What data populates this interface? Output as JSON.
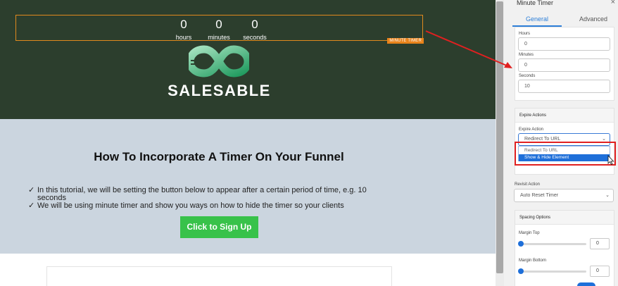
{
  "timer": {
    "hours_value": "0",
    "hours_label": "hours",
    "minutes_value": "0",
    "minutes_label": "minutes",
    "seconds_value": "0",
    "seconds_label": "seconds",
    "tag": "MINUTE TIMER"
  },
  "hero": {
    "brand": "SALESABLE",
    "logo_icon": "infinity-logo-icon"
  },
  "content": {
    "headline": "How To Incorporate A Timer On Your Funnel",
    "bullets": [
      "In this tutorial, we will be setting the button below to appear after a certain period of time, e.g. 10 seconds",
      "We will be using minute timer and show you ways on how to hide the timer so your clients"
    ],
    "check_glyph": "✓",
    "cta": "Click to Sign Up"
  },
  "panel": {
    "title": "Minute Timer",
    "close_glyph": "×",
    "tabs": [
      "General",
      "Advanced"
    ],
    "time_fields": {
      "hours_label": "Hours",
      "hours_value": "0",
      "minutes_label": "Minutes",
      "minutes_value": "0",
      "seconds_label": "Seconds",
      "seconds_value": "10"
    },
    "expire": {
      "heading": "Expire Actions",
      "action_label": "Expire Action",
      "action_value": "Redirect To URL",
      "options": [
        "Redirect To URL",
        "Show & Hide Element"
      ],
      "selected_option": "Show & Hide Element"
    },
    "revisit": {
      "label": "Revisit Action",
      "value": "Auto Reset Timer"
    },
    "spacing": {
      "heading": "Spacing Options",
      "margin_top_label": "Margin Top",
      "margin_top_value": "0",
      "margin_bottom_label": "Margin Bottom",
      "margin_bottom_value": "0"
    }
  },
  "colors": {
    "hero_bg": "#2c3e2d",
    "timer_border": "#e08a1e",
    "cta_bg": "#38c24a",
    "accent_blue": "#1e6fd9",
    "annotation_red": "#e02020"
  }
}
